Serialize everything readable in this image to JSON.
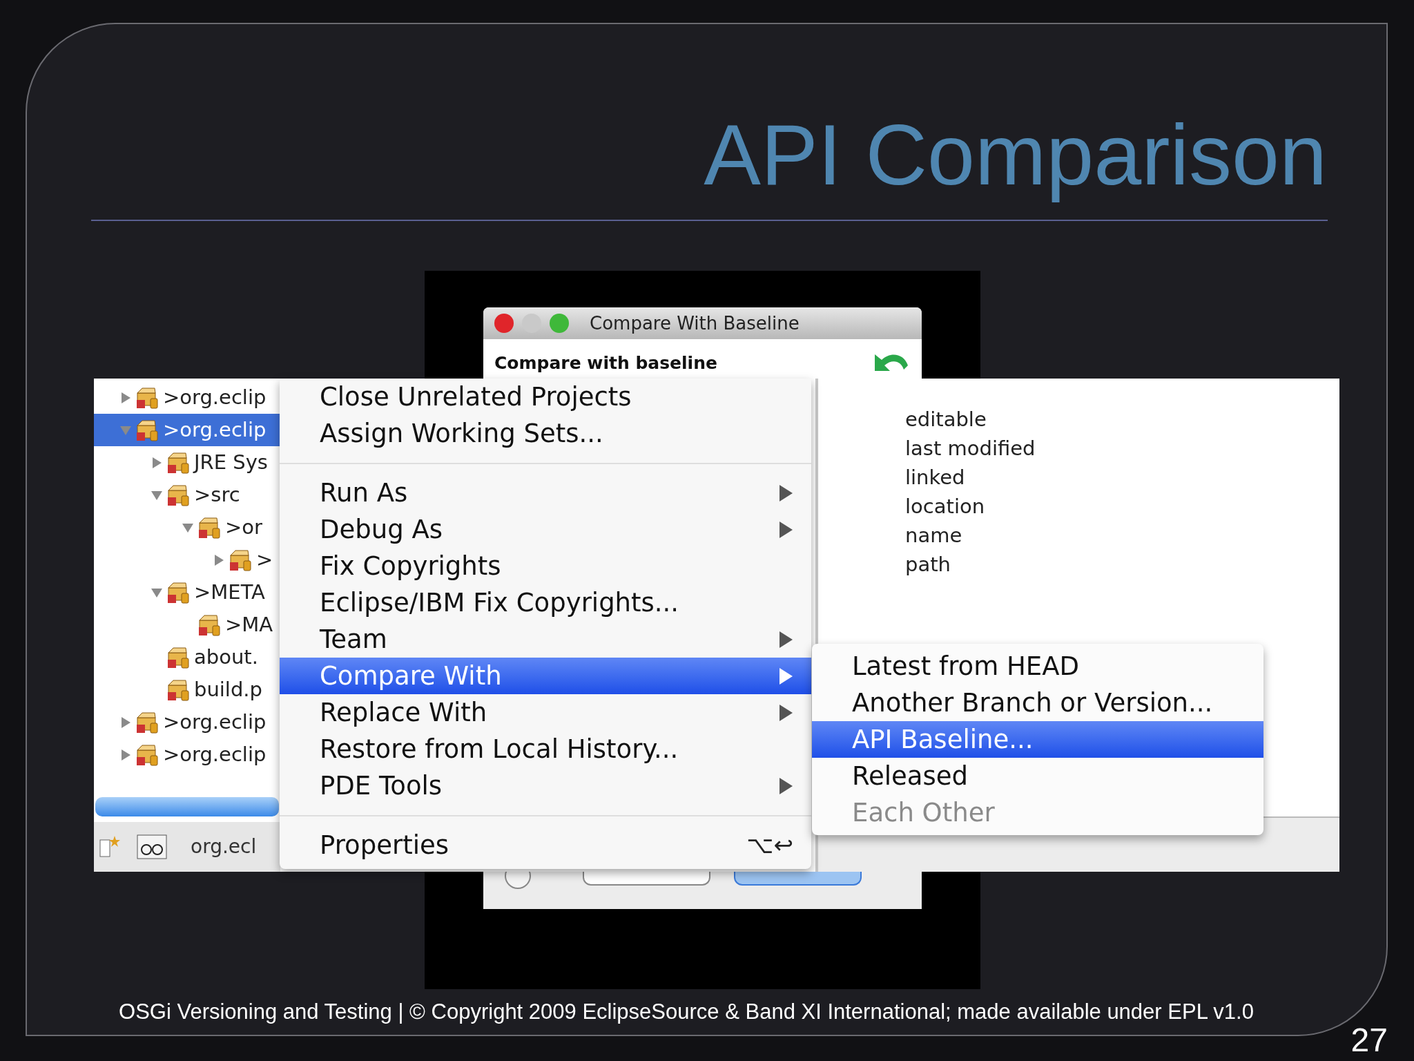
{
  "slide": {
    "title": "API Comparison",
    "footer": "OSGi Versioning and Testing | © Copyright 2009 EclipseSource & Band XI International; made available under EPL v1.0",
    "page_number": "27"
  },
  "dialog": {
    "title": "Compare With Baseline",
    "heading": "Compare with baseline"
  },
  "tree": [
    {
      "label": ">org.eclip",
      "selected": false,
      "expanded": false
    },
    {
      "label": ">org.eclip",
      "selected": true,
      "expanded": true,
      "children": [
        {
          "label": "JRE Sys",
          "selected": false,
          "expanded": false
        },
        {
          "label": ">src",
          "selected": false,
          "expanded": true,
          "children": [
            {
              "label": ">or",
              "selected": false,
              "expanded": true,
              "children": [
                {
                  "label": ">",
                  "selected": false,
                  "expanded": false
                }
              ]
            }
          ]
        },
        {
          "label": ">META",
          "selected": false,
          "expanded": true,
          "children": [
            {
              "label": ">MA",
              "selected": false
            }
          ]
        },
        {
          "label": "about.",
          "selected": false
        },
        {
          "label": "build.p",
          "selected": false
        }
      ]
    },
    {
      "label": ">org.eclip",
      "selected": false,
      "expanded": false
    },
    {
      "label": ">org.eclip",
      "selected": false,
      "expanded": false
    }
  ],
  "status_bar": {
    "text": "org.ecl"
  },
  "context_menu": [
    {
      "kind": "item",
      "label": "Close Unrelated Projects",
      "selected": false,
      "submenu": false
    },
    {
      "kind": "item",
      "label": "Assign Working Sets...",
      "selected": false,
      "submenu": false
    },
    {
      "kind": "separator"
    },
    {
      "kind": "item",
      "label": "Run As",
      "selected": false,
      "submenu": true
    },
    {
      "kind": "item",
      "label": "Debug As",
      "selected": false,
      "submenu": true
    },
    {
      "kind": "item",
      "label": "Fix Copyrights",
      "selected": false,
      "submenu": false
    },
    {
      "kind": "item",
      "label": "Eclipse/IBM Fix Copyrights...",
      "selected": false,
      "submenu": false
    },
    {
      "kind": "item",
      "label": "Team",
      "selected": false,
      "submenu": true
    },
    {
      "kind": "item",
      "label": "Compare With",
      "selected": true,
      "submenu": true
    },
    {
      "kind": "item",
      "label": "Replace With",
      "selected": false,
      "submenu": true
    },
    {
      "kind": "item",
      "label": "Restore from Local History...",
      "selected": false,
      "submenu": false
    },
    {
      "kind": "item",
      "label": "PDE Tools",
      "selected": false,
      "submenu": true
    },
    {
      "kind": "separator"
    },
    {
      "kind": "item",
      "label": "Properties",
      "selected": false,
      "submenu": false,
      "shortcut": "⌥↩"
    }
  ],
  "properties_list": [
    "editable",
    "last modified",
    "linked",
    "location",
    "name",
    "path"
  ],
  "submenu": [
    {
      "label": "Latest from HEAD",
      "selected": false,
      "disabled": false
    },
    {
      "label": "Another Branch or Version...",
      "selected": false,
      "disabled": false
    },
    {
      "label": "API Baseline...",
      "selected": true,
      "disabled": false
    },
    {
      "label": "Released",
      "selected": false,
      "disabled": false
    },
    {
      "label": "Each Other",
      "selected": false,
      "disabled": true
    }
  ]
}
